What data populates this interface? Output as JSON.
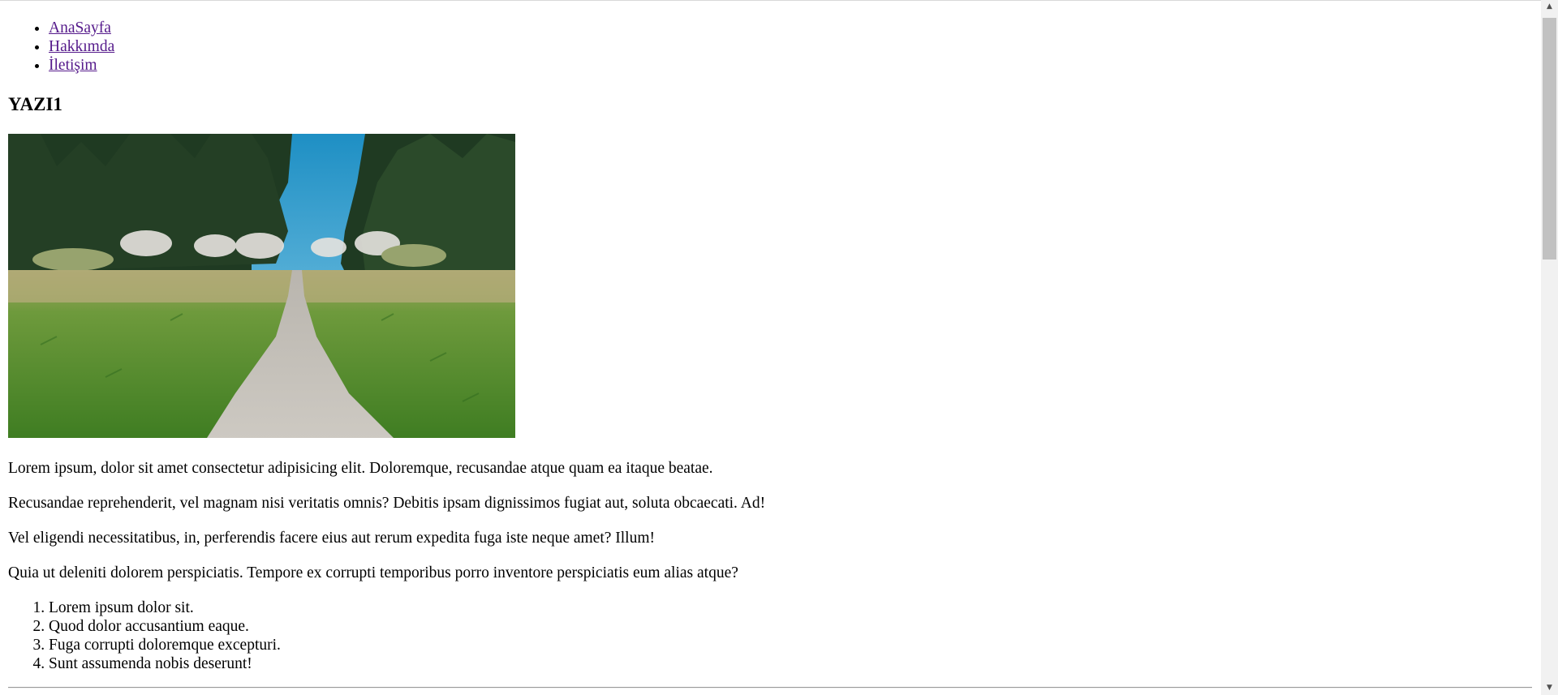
{
  "nav": {
    "items": [
      {
        "label": "AnaSayfa"
      },
      {
        "label": "Hakkımda"
      },
      {
        "label": "İletişim"
      }
    ]
  },
  "post": {
    "title": "YAZI1",
    "image_alt": "Forest path through a grassy meadow",
    "paragraphs": [
      "Lorem ipsum, dolor sit amet consectetur adipisicing elit. Doloremque, recusandae atque quam ea itaque beatae.",
      "Recusandae reprehenderit, vel magnam nisi veritatis omnis? Debitis ipsam dignissimos fugiat aut, soluta obcaecati. Ad!",
      "Vel eligendi necessitatibus, in, perferendis facere eius aut rerum expedita fuga iste neque amet? Illum!",
      "Quia ut deleniti dolorem perspiciatis. Tempore ex corrupti temporibus porro inventore perspiciatis eum alias atque?"
    ],
    "list": [
      "Lorem ipsum dolor sit.",
      "Quod dolor accusantium eaque.",
      "Fuga corrupti doloremque excepturi.",
      "Sunt assumenda nobis deserunt!"
    ]
  },
  "colors": {
    "visited_link": "#551a8b",
    "scrollbar_track": "#f1f1f1",
    "scrollbar_thumb": "#c1c1c1"
  },
  "icons": {
    "scroll_up": "scroll-up-arrow-icon",
    "scroll_down": "scroll-down-arrow-icon"
  }
}
